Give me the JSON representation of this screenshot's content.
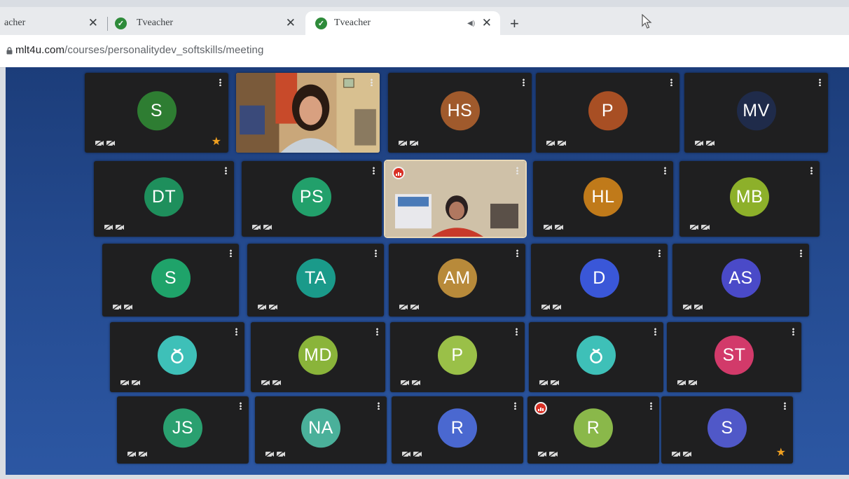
{
  "browser": {
    "tabs": [
      {
        "title": "acher",
        "active": false
      },
      {
        "title": "Tveacher",
        "active": false
      },
      {
        "title": "Tveacher",
        "active": true
      }
    ],
    "close_glyph": "✕",
    "new_tab_glyph": "+",
    "audio_glyph": "◀)",
    "url_host": "mlt4u.com",
    "url_path": "/courses/personalitydev_softskills/meeting"
  },
  "meeting": {
    "tiles": [
      {
        "initials": "S",
        "color": "#2e7d32",
        "star": true
      },
      {
        "video": "teacher-woman"
      },
      {
        "initials": "HS",
        "color": "#a05a2c"
      },
      {
        "initials": "P",
        "color": "#a84f24"
      },
      {
        "initials": "MV",
        "color": "#1f2b4a"
      },
      {
        "initials": "DT",
        "color": "#1e8f5c"
      },
      {
        "initials": "PS",
        "color": "#22a06b"
      },
      {
        "video": "speaker-woman",
        "speaking": true
      },
      {
        "initials": "HL",
        "color": "#c07a1a"
      },
      {
        "initials": "MB",
        "color": "#8db02a"
      },
      {
        "initials": "S",
        "color": "#1fa36a"
      },
      {
        "initials": "TA",
        "color": "#1a9a8a"
      },
      {
        "initials": "AM",
        "color": "#b88a3a"
      },
      {
        "initials": "D",
        "color": "#3a57d8"
      },
      {
        "initials": "AS",
        "color": "#4a4ac8"
      },
      {
        "icon": "user-placeholder",
        "color": "#3ec0b8"
      },
      {
        "initials": "MD",
        "color": "#8ab43a"
      },
      {
        "initials": "P",
        "color": "#9ac048"
      },
      {
        "icon": "user-placeholder",
        "color": "#3ec0b8"
      },
      {
        "initials": "ST",
        "color": "#d23a6a"
      },
      {
        "initials": "JS",
        "color": "#2aa070"
      },
      {
        "initials": "NA",
        "color": "#4ab09a"
      },
      {
        "initials": "R",
        "color": "#4a68d0"
      },
      {
        "initials": "R",
        "color": "#8ab84a",
        "speaking": true
      },
      {
        "initials": "S",
        "color": "#5058c8",
        "star": true
      }
    ]
  }
}
